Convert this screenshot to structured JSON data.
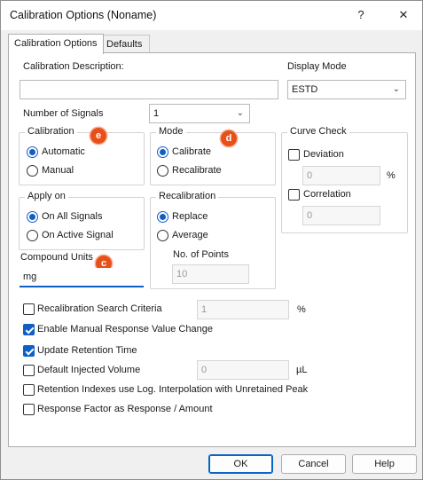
{
  "window": {
    "title": "Calibration Options (Noname)",
    "help_glyph": "?",
    "close_glyph": "✕"
  },
  "tabs": [
    {
      "label": "Calibration Options"
    },
    {
      "label": "Defaults"
    }
  ],
  "description": {
    "label": "Calibration Description:",
    "value": ""
  },
  "display_mode": {
    "label": "Display Mode",
    "value": "ESTD"
  },
  "signals": {
    "label": "Number of Signals",
    "value": "1"
  },
  "calibration": {
    "legend": "Calibration",
    "badge": "e",
    "options": [
      "Automatic",
      "Manual"
    ],
    "selected": "Automatic"
  },
  "mode": {
    "legend": "Mode",
    "badge": "d",
    "options": [
      "Calibrate",
      "Recalibrate"
    ],
    "selected": "Calibrate"
  },
  "curve_check": {
    "legend": "Curve Check",
    "deviation": {
      "label": "Deviation",
      "value": "0",
      "unit": "%"
    },
    "correlation": {
      "label": "Correlation",
      "value": "0"
    }
  },
  "apply_on": {
    "legend": "Apply on",
    "options": [
      "On All Signals",
      "On Active Signal"
    ],
    "selected": "On All Signals"
  },
  "recalibration": {
    "legend": "Recalibration",
    "options": [
      "Replace",
      "Average"
    ],
    "selected": "Replace",
    "points_label": "No. of Points",
    "points_value": "10"
  },
  "compound_units": {
    "label": "Compound Units",
    "badge": "c",
    "value": "mg"
  },
  "options": {
    "search_criteria": {
      "label": "Recalibration Search Criteria",
      "value": "1",
      "unit": "%"
    },
    "manual_response": {
      "label": "Enable Manual Response Value Change"
    },
    "update_retention": {
      "label": "Update Retention Time"
    },
    "default_volume": {
      "label": "Default Injected Volume",
      "value": "0",
      "unit": "µL"
    },
    "retention_indexes": {
      "label": "Retention Indexes use Log. Interpolation with Unretained Peak"
    },
    "response_factor": {
      "label": "Response Factor as Response / Amount"
    }
  },
  "buttons": {
    "ok": "OK",
    "cancel": "Cancel",
    "help": "Help"
  },
  "colors": {
    "accent": "#0f5fc4",
    "badge": "#e8501a",
    "panel": "#ffffff",
    "dialog_bg": "#f0f0f0"
  }
}
